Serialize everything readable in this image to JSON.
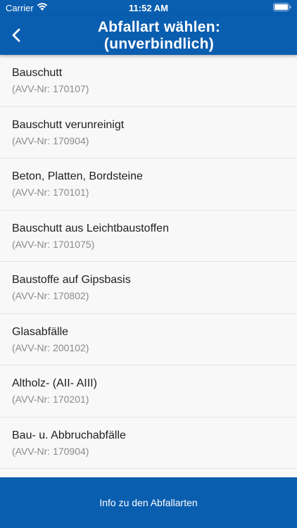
{
  "status_bar": {
    "carrier": "Carrier",
    "time": "11:52 AM",
    "wifi_icon": "wifi-icon",
    "battery_icon": "battery-icon"
  },
  "header": {
    "title_line1": "Abfallart wählen:",
    "title_line2": "(unverbindlich)",
    "back_icon": "chevron-left-icon",
    "background": "#0a5eb0"
  },
  "waste_types": [
    {
      "name": "Bauschutt",
      "code": "(AVV-Nr: 170107)"
    },
    {
      "name": "Bauschutt verunreinigt",
      "code": "(AVV-Nr: 170904)"
    },
    {
      "name": "Beton, Platten, Bordsteine",
      "code": "(AVV-Nr: 170101)"
    },
    {
      "name": "Bauschutt aus Leichtbaustoffen",
      "code": "(AVV-Nr: 1701075)"
    },
    {
      "name": "Baustoffe auf Gipsbasis",
      "code": "(AVV-Nr: 170802)"
    },
    {
      "name": "Glasabfälle",
      "code": "(AVV-Nr: 200102)"
    },
    {
      "name": "Altholz- (AII- AIII)",
      "code": "(AVV-Nr: 170201)"
    },
    {
      "name": "Bau- u. Abbruchabfälle",
      "code": "(AVV-Nr: 170904)"
    }
  ],
  "footer": {
    "info_button": "Info zu den Abfallarten"
  }
}
